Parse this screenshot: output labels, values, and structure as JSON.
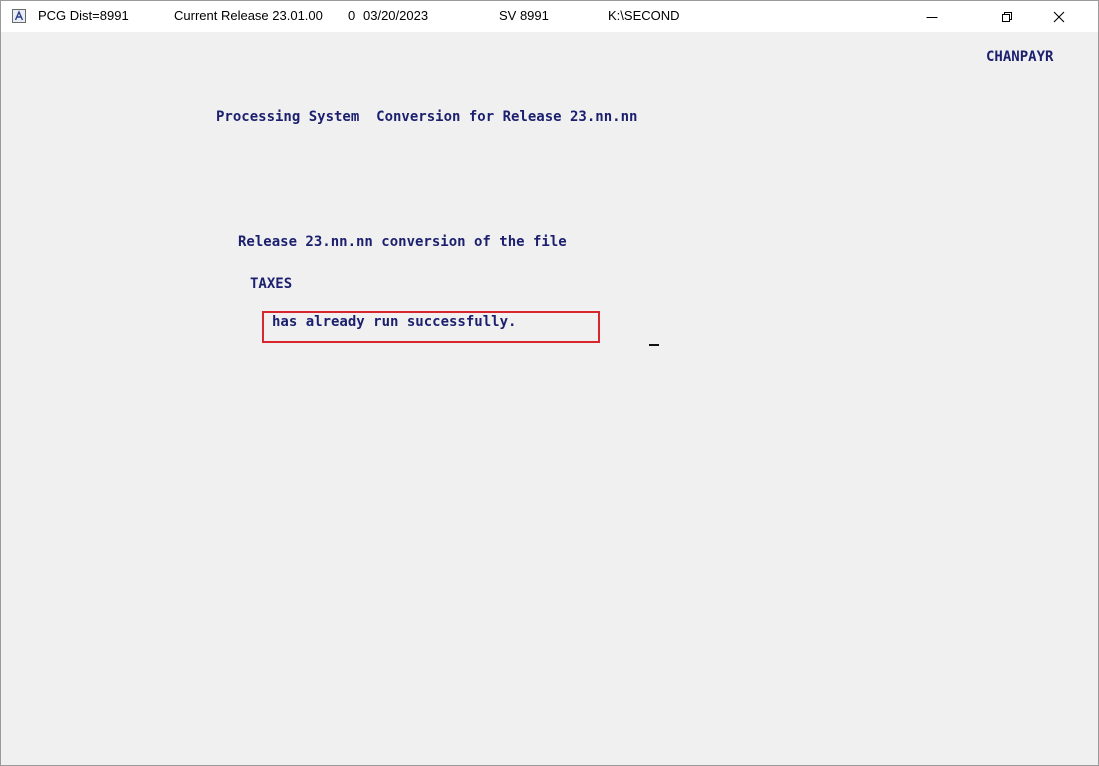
{
  "titlebar": {
    "app_icon": "terminal-app-icon",
    "dist": "PCG Dist=8991",
    "release": "Current Release 23.01.00",
    "release_suffix": "0",
    "date": "03/20/2023",
    "sv": "SV 8991",
    "path": "K:\\SECOND",
    "controls": [
      "minimize-icon",
      "restore-icon",
      "close-icon"
    ]
  },
  "screen": {
    "program_name": "CHANPAYR",
    "heading": "Processing System  Conversion for Release 23.nn.nn",
    "line1": "Release 23.nn.nn conversion of the file",
    "file_name": "TAXES",
    "status": "has already run successfully."
  },
  "colors": {
    "text": "#1b1f6e",
    "background": "#f0f0f0",
    "highlight": "#d9262e"
  }
}
